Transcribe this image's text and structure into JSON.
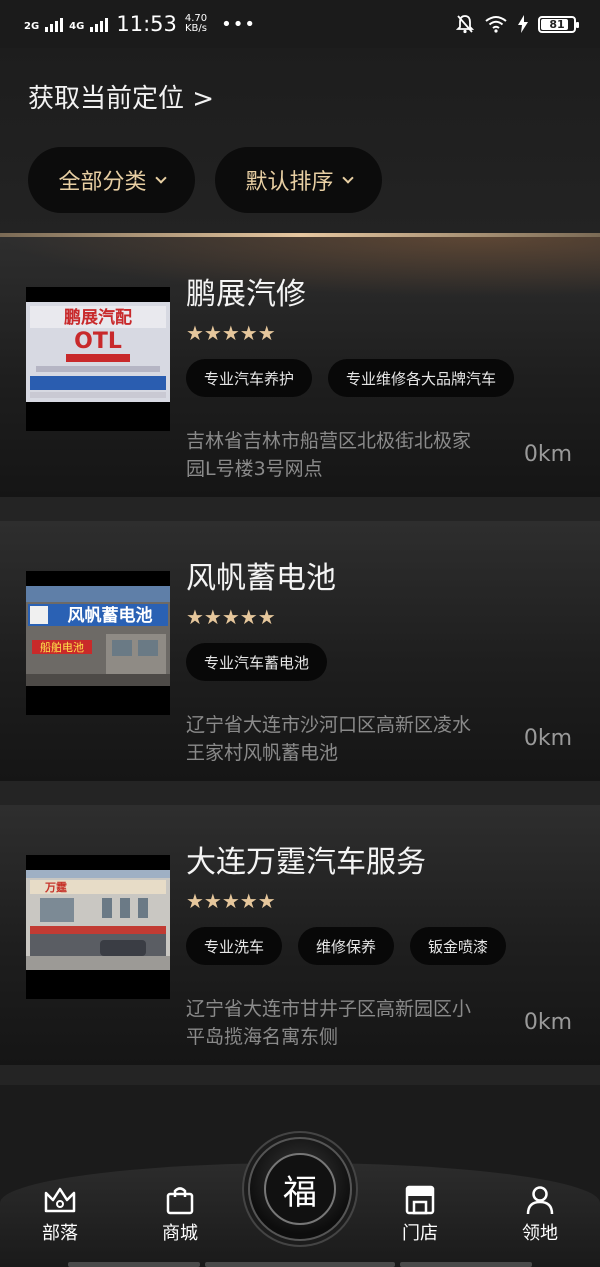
{
  "status_bar": {
    "net1": "2G",
    "net2": "4G",
    "time": "11:53",
    "speed_value": "4.70",
    "speed_unit": "KB/s",
    "dots": "•••",
    "battery": "81"
  },
  "header": {
    "location_label": "获取当前定位 >",
    "filters": [
      {
        "label": "全部分类"
      },
      {
        "label": "默认排序"
      }
    ]
  },
  "stores": [
    {
      "name": "鹏展汽修",
      "rating": 5,
      "stars": "★★★★★",
      "tags": [
        "专业汽车养护",
        "专业维修各大品牌汽车"
      ],
      "address": "吉林省吉林市船营区北极街北极家园L号楼3号网点",
      "distance": "0km",
      "sign_text": "鹏展汽配",
      "sign_brand": "OTL"
    },
    {
      "name": "风帆蓄电池",
      "rating": 5,
      "stars": "★★★★★",
      "tags": [
        "专业汽车蓄电池"
      ],
      "address": "辽宁省大连市沙河口区高新区凌水王家村风帆蓄电池",
      "distance": "0km",
      "sign_text": "风帆蓄电池",
      "sign_sub": "船舶电池"
    },
    {
      "name": "大连万霆汽车服务",
      "rating": 5,
      "stars": "★★★★★",
      "tags": [
        "专业洗车",
        "维修保养",
        "钣金喷漆"
      ],
      "address": "辽宁省大连市甘井子区高新园区小平岛揽海名寓东侧",
      "distance": "0km",
      "sign_text": "万霆"
    }
  ],
  "bottom_nav": {
    "items": [
      {
        "label": "部落",
        "icon": "crown-icon"
      },
      {
        "label": "商城",
        "icon": "shopping-bag-icon"
      },
      {
        "label": "门店",
        "icon": "storefront-icon"
      },
      {
        "label": "领地",
        "icon": "user-icon"
      }
    ],
    "center_glyph": "福"
  },
  "colors": {
    "accent_gold": "#e6c79c",
    "background": "#1b1b1b",
    "pill_bg": "#080808"
  }
}
